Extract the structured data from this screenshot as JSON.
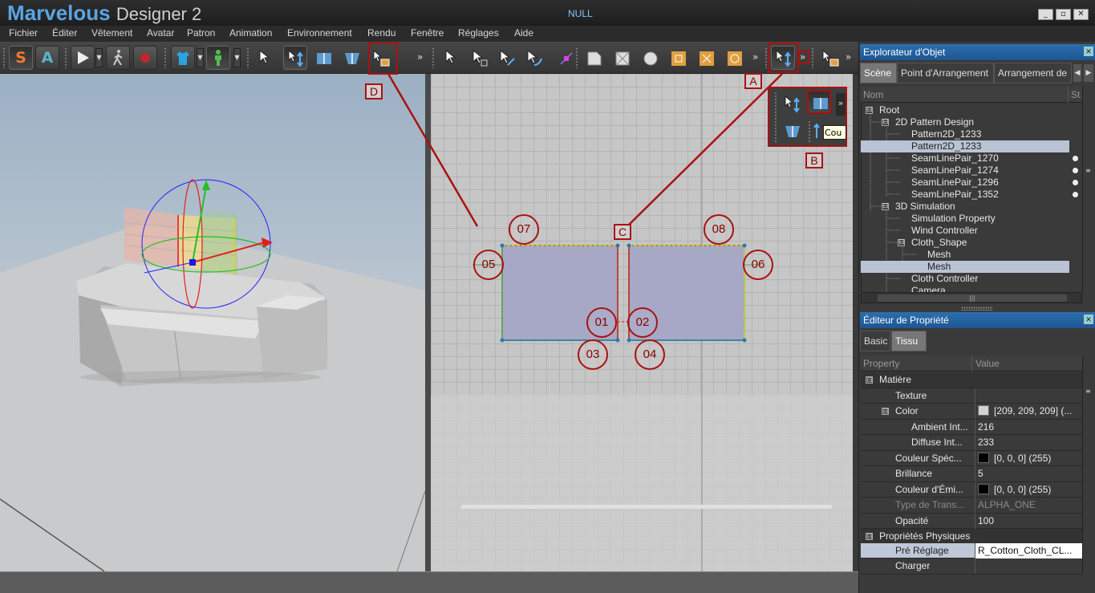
{
  "window": {
    "app_name": "Marvelous",
    "app_version": "Designer 2",
    "document_title": "NULL",
    "controls": [
      "_",
      "▫",
      "✕"
    ]
  },
  "menu": [
    "Fichier",
    "Éditer",
    "Vêtement",
    "Avatar",
    "Patron",
    "Animation",
    "Environnement",
    "Rendu",
    "Fenêtre",
    "Réglages",
    "Aide"
  ],
  "toolbar": {
    "s_label": "S",
    "a_label": "A",
    "more": "»"
  },
  "annotations": {
    "letters": [
      "A",
      "B",
      "C",
      "D"
    ],
    "circles": [
      "01",
      "02",
      "03",
      "04",
      "05",
      "06",
      "07",
      "08"
    ]
  },
  "popup": {
    "tooltip": "Cou"
  },
  "object_explorer": {
    "title": "Explorateur d'Objet",
    "tabs": [
      "Scène",
      "Point d'Arrangement",
      "Arrangement de"
    ],
    "col_name": "Nom",
    "col_status": "St",
    "tree": [
      {
        "label": "Root",
        "expander": "⊟"
      },
      {
        "label": "2D Pattern Design",
        "expander": "⊟"
      },
      {
        "label": "Pattern2D_1233"
      },
      {
        "label": "Pattern2D_1233"
      },
      {
        "label": "SeamLinePair_1270"
      },
      {
        "label": "SeamLinePair_1274"
      },
      {
        "label": "SeamLinePair_1296"
      },
      {
        "label": "SeamLinePair_1352"
      },
      {
        "label": "3D Simulation",
        "expander": "⊟"
      },
      {
        "label": "Simulation Property"
      },
      {
        "label": "Wind Controller"
      },
      {
        "label": "Cloth_Shape",
        "expander": "⊟"
      },
      {
        "label": "Mesh"
      },
      {
        "label": "Mesh"
      },
      {
        "label": "Cloth Controller"
      },
      {
        "label": "Camera"
      }
    ]
  },
  "property_editor": {
    "title": "Éditeur de Propriété",
    "tabs": [
      "Basic",
      "Tissu"
    ],
    "col_property": "Property",
    "col_value": "Value",
    "rows": [
      {
        "name": "Matière",
        "value": "",
        "expander": "⊟"
      },
      {
        "name": "Texture",
        "value": ""
      },
      {
        "name": "Color",
        "value": "[209, 209, 209] (...",
        "swatch": "#d1d1d1",
        "expander": "⊟"
      },
      {
        "name": "Ambient Int...",
        "value": "216"
      },
      {
        "name": "Diffuse Int...",
        "value": "233"
      },
      {
        "name": "Couleur Spéc...",
        "value": "[0, 0, 0] (255)",
        "swatch": "#000000"
      },
      {
        "name": "Brillance",
        "value": "5"
      },
      {
        "name": "Couleur d'Émi...",
        "value": "[0, 0, 0] (255)",
        "swatch": "#000000"
      },
      {
        "name": "Type de Trans...",
        "value": "ALPHA_ONE"
      },
      {
        "name": "Opacité",
        "value": "100"
      },
      {
        "name": "Propriétés Physiques",
        "value": "",
        "expander": "⊟"
      },
      {
        "name": "Pré Réglage",
        "value": "R_Cotton_Cloth_CL..."
      },
      {
        "name": "Charger",
        "value": ""
      }
    ]
  },
  "colors": {
    "accent": "#2c6fae",
    "annotation": "#a11111",
    "pattern_fill": "#a7a8c6"
  }
}
